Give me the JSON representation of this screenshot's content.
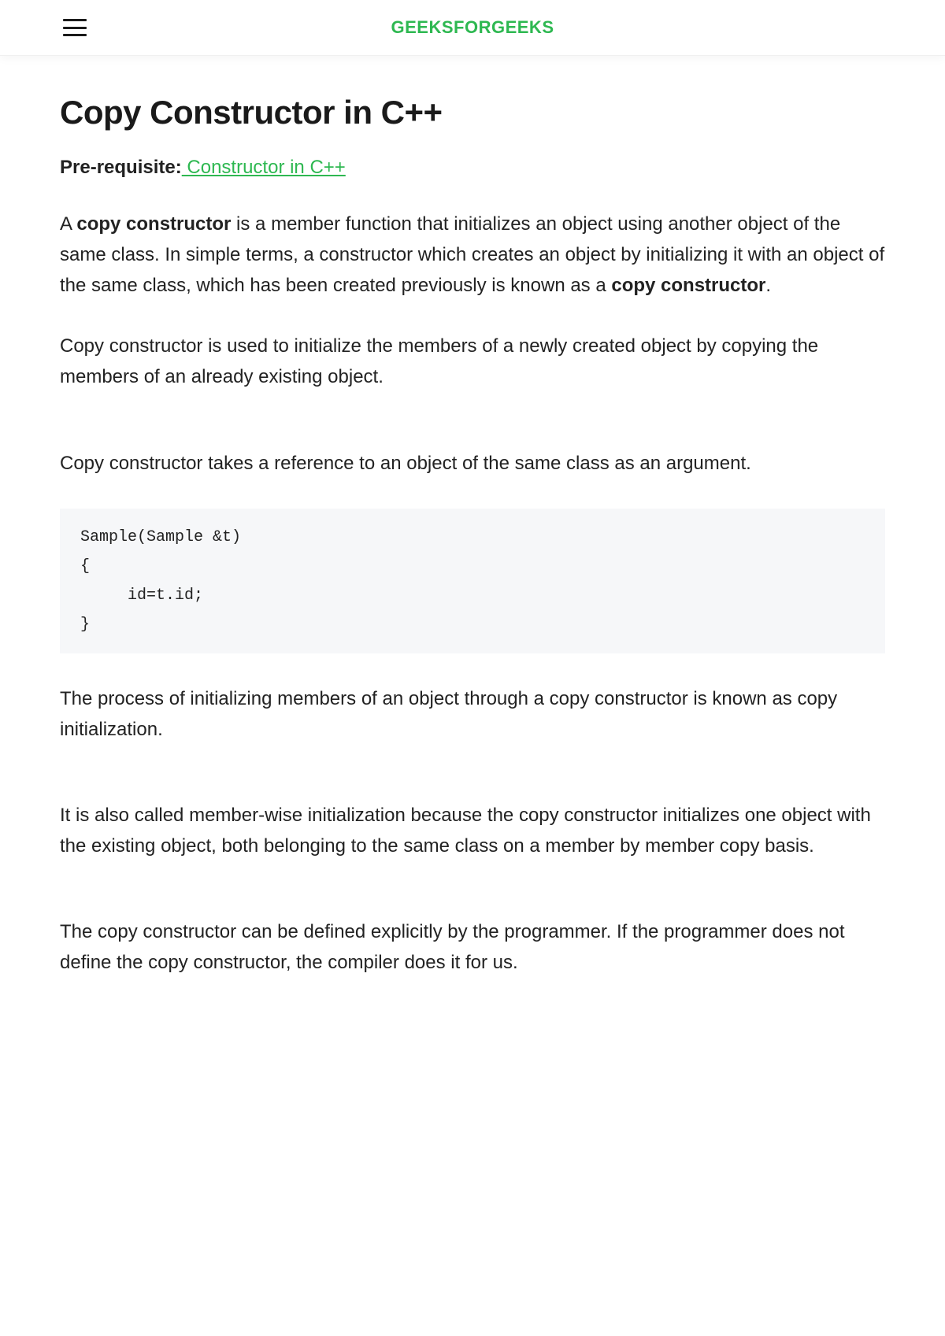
{
  "header": {
    "brand": "GEEKSFORGEEKS"
  },
  "article": {
    "title": "Copy Constructor in C++",
    "prereq_label": "Pre-requisite:",
    "prereq_link_text": " Constructor in C++ ",
    "para1_before": "A ",
    "para1_strong1": "copy constructor",
    "para1_mid": " is a member function that initializes an object using another object of the same class. In simple terms, a constructor which creates an object by initializing it with an object of the same class, which has been created previously is known as a ",
    "para1_strong2": "copy constructor",
    "para1_after": ".",
    "para2": "Copy constructor is used to initialize the members of a newly created object by copying the members of an already existing object.",
    "para3": "Copy constructor takes a reference to an object of the same class as an argument.",
    "code_block": "Sample(Sample &t)\n{\n     id=t.id;\n}",
    "para4": "The process of initializing members of an object through a copy constructor is known as copy initialization.",
    "para5": "It is also called member-wise initialization because the copy constructor initializes one object with the existing object, both belonging to the same class on a member by member copy basis.",
    "para6": "The copy constructor can be defined explicitly by the programmer. If the programmer does not define the copy constructor, the compiler does it for us."
  }
}
